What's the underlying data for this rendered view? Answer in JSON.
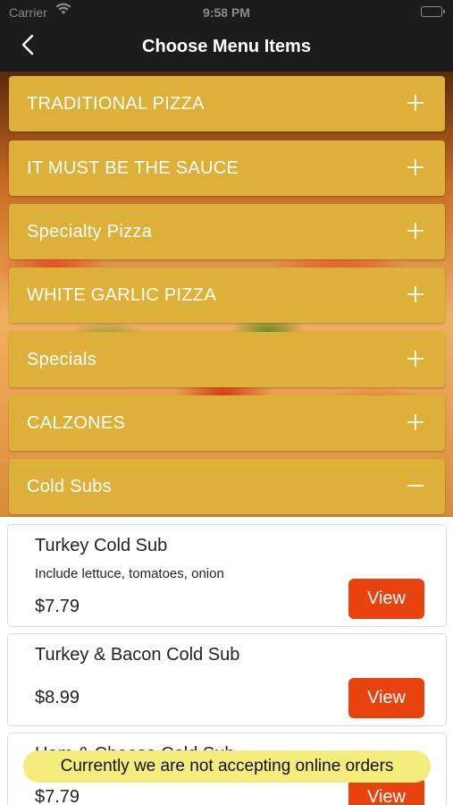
{
  "status_bar": {
    "carrier": "Carrier",
    "time": "9:58 PM",
    "wifi_icon": "wifi-icon",
    "battery_icon": "battery-icon"
  },
  "nav": {
    "back_icon": "chevron-left-icon",
    "title": "Choose Menu Items"
  },
  "categories": [
    {
      "label": "TRADITIONAL PIZZA",
      "expanded": false
    },
    {
      "label": "IT MUST BE THE SAUCE",
      "expanded": false
    },
    {
      "label": "Specialty Pizza",
      "expanded": false
    },
    {
      "label": "WHITE GARLIC PIZZA",
      "expanded": false
    },
    {
      "label": "Specials",
      "expanded": false
    },
    {
      "label": "CALZONES",
      "expanded": false
    },
    {
      "label": "Cold Subs",
      "expanded": true
    }
  ],
  "items": [
    {
      "name": "Turkey Cold Sub",
      "description": "Include lettuce, tomatoes, onion",
      "price": "$7.79",
      "button": "View"
    },
    {
      "name": "Turkey & Bacon Cold Sub",
      "description": "",
      "price": "$8.99",
      "button": "View"
    },
    {
      "name": "Ham & Cheese Cold Sub",
      "description": "",
      "price": "$7.79",
      "button": "View"
    }
  ],
  "toast": {
    "text": "Currently we are not accepting online orders"
  },
  "colors": {
    "category_bg": "#ddb03a",
    "view_button": "#e8420f",
    "toast_bg": "#f4ec7c",
    "nav_bg": "#1c1c1c"
  }
}
